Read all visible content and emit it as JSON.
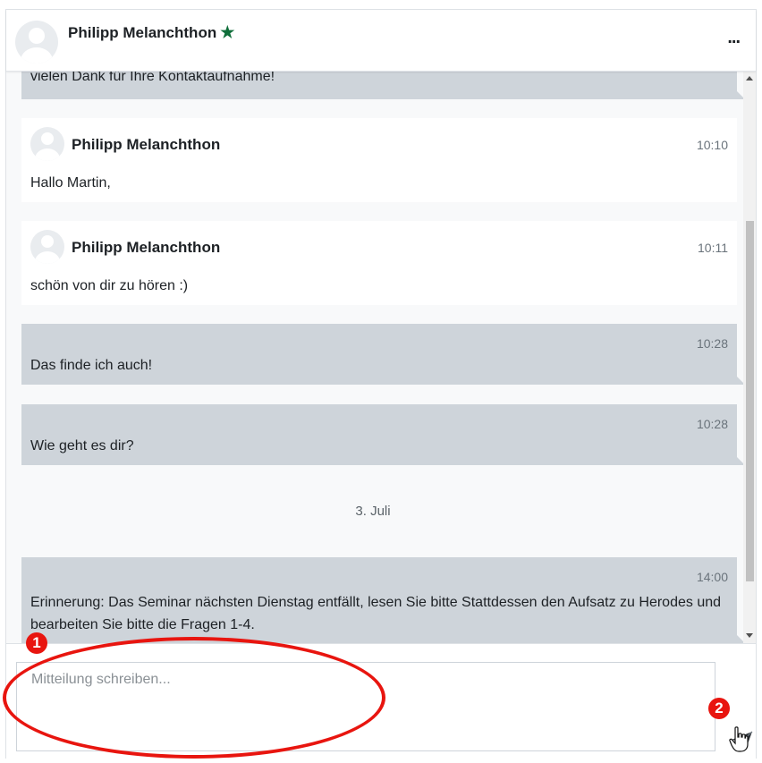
{
  "header": {
    "contact_name": "Philipp Melanchthon",
    "star_icon": "star-icon",
    "more_label": "..."
  },
  "messages": {
    "partial_top_text": "vielen Dank für Ihre Kontaktaufnahme!",
    "items": [
      {
        "type": "received",
        "sender": "Philipp Melanchthon",
        "time": "10:10",
        "text": "Hallo Martin,"
      },
      {
        "type": "received",
        "sender": "Philipp Melanchthon",
        "time": "10:11",
        "text": "schön von dir zu hören :)"
      },
      {
        "type": "sent",
        "time": "10:28",
        "text": "Das finde ich auch!"
      },
      {
        "type": "sent",
        "time": "10:28",
        "text": "Wie geht es dir?"
      },
      {
        "type": "sent",
        "time": "14:00",
        "text": "Erinnerung: Das Seminar nächsten Dienstag entfällt, lesen Sie bitte Stattdessen den Aufsatz zu Herodes und bearbeiten Sie bitte die Fragen 1-4."
      }
    ],
    "date_separator": "3. Juli"
  },
  "composer": {
    "placeholder": "Mitteilung schreiben...",
    "send_icon": "paper-plane-icon"
  },
  "annotations": {
    "badge_1": "1",
    "badge_2": "2"
  },
  "colors": {
    "sent_bubble": "#ced4da",
    "received_bubble": "#ffffff",
    "annotation_red": "#e8150f",
    "star_green": "#0f6e3a"
  }
}
